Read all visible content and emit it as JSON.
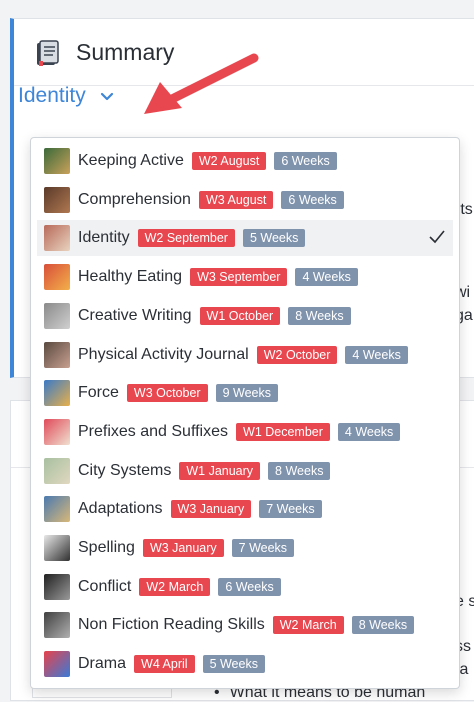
{
  "summary": {
    "title": "Summary",
    "selected_unit": "Identity"
  },
  "background_fragments": [
    "rts",
    "wi",
    "ga",
    "e s",
    "ss",
    "fa"
  ],
  "background_bullet": "What it means to be human",
  "units": [
    {
      "name": "Keeping Active",
      "start": "W2 August",
      "duration": "6 Weeks",
      "thumb": [
        "#3a6a3a",
        "#c9a15a"
      ]
    },
    {
      "name": "Comprehension",
      "start": "W3 August",
      "duration": "6 Weeks",
      "thumb": [
        "#5a3a2a",
        "#b07850"
      ]
    },
    {
      "name": "Identity",
      "start": "W2 September",
      "duration": "5 Weeks",
      "thumb": [
        "#b86a5a",
        "#e8d3bf"
      ]
    },
    {
      "name": "Healthy Eating",
      "start": "W3 September",
      "duration": "4 Weeks",
      "thumb": [
        "#d84f3a",
        "#f3b04a"
      ]
    },
    {
      "name": "Creative Writing",
      "start": "W1 October",
      "duration": "8 Weeks",
      "thumb": [
        "#8a8a8a",
        "#d0d0d0"
      ]
    },
    {
      "name": "Physical Activity Journal",
      "start": "W2 October",
      "duration": "4 Weeks",
      "thumb": [
        "#5a4a40",
        "#c8a090"
      ]
    },
    {
      "name": "Force",
      "start": "W3 October",
      "duration": "9 Weeks",
      "thumb": [
        "#3a7ac8",
        "#e8b04a"
      ]
    },
    {
      "name": "Prefixes and Suffixes",
      "start": "W1 December",
      "duration": "4 Weeks",
      "thumb": [
        "#e04a5a",
        "#f0e0d0"
      ]
    },
    {
      "name": "City Systems",
      "start": "W1 January",
      "duration": "8 Weeks",
      "thumb": [
        "#a8c0a0",
        "#e0d8c0"
      ]
    },
    {
      "name": "Adaptations",
      "start": "W3 January",
      "duration": "7 Weeks",
      "thumb": [
        "#4a7ab0",
        "#d8b878"
      ]
    },
    {
      "name": "Spelling",
      "start": "W3 January",
      "duration": "7 Weeks",
      "thumb": [
        "#e8e8e8",
        "#303030"
      ]
    },
    {
      "name": "Conflict",
      "start": "W2 March",
      "duration": "6 Weeks",
      "thumb": [
        "#202020",
        "#9a9a9a"
      ]
    },
    {
      "name": "Non Fiction Reading Skills",
      "start": "W2 March",
      "duration": "8 Weeks",
      "thumb": [
        "#404040",
        "#b0b0b0"
      ]
    },
    {
      "name": "Drama",
      "start": "W4 April",
      "duration": "5 Weeks",
      "thumb": [
        "#e8424a",
        "#3a7ad8"
      ]
    }
  ],
  "selected_index": 2,
  "colors": {
    "accent": "#3d86d8",
    "date_badge": "#e8474f",
    "duration_badge": "#8093ad",
    "arrow": "#e8474f"
  },
  "icons": {
    "title": "book-icon",
    "select": "chevron-down-icon",
    "selected": "check-icon",
    "annotation": "arrow-icon"
  }
}
